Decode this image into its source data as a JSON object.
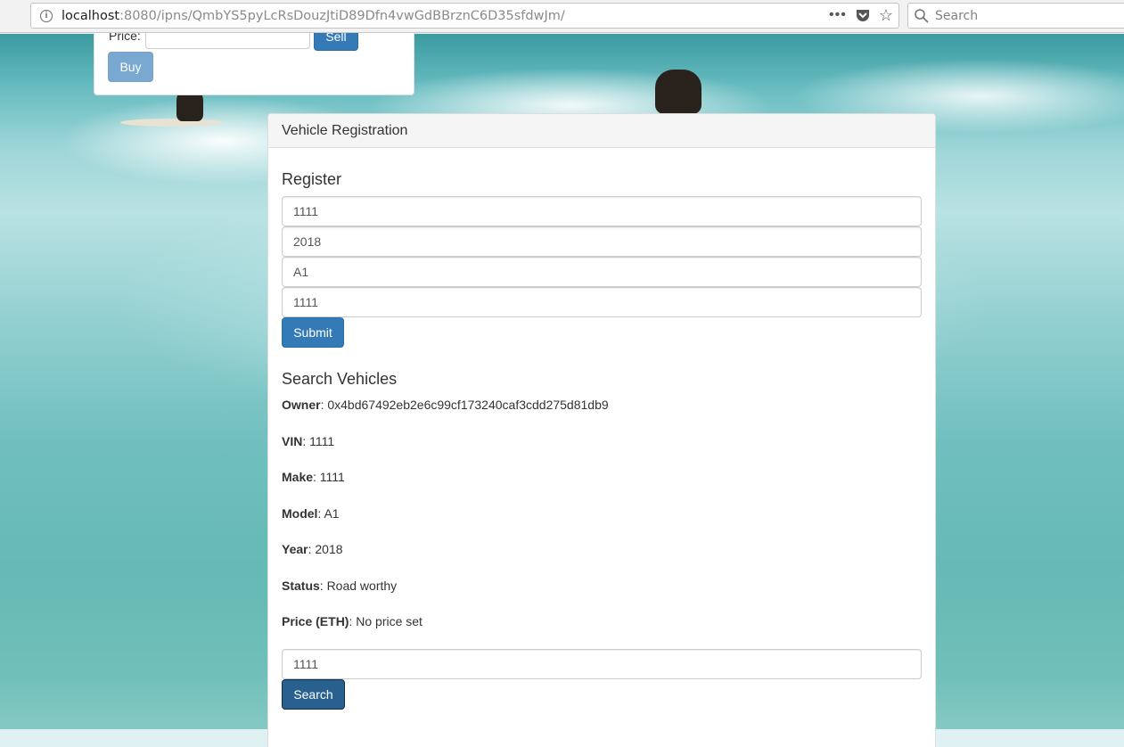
{
  "browser": {
    "url_host": "localhost",
    "url_rest": ":8080/ipns/QmbYS5pyLcRsDouzJtiD89Dfn4vwGdBBrznC6D35sfdwJm/",
    "search_placeholder": "Search",
    "icons": [
      "info-icon",
      "more-dots-icon",
      "pocket-icon",
      "bookmark-star-icon",
      "search-icon"
    ]
  },
  "trade_panel": {
    "price_label": "Price:",
    "price_value": "",
    "sell_label": "Sell",
    "buy_label": "Buy"
  },
  "registration": {
    "heading": "Vehicle Registration",
    "register_title": "Register",
    "fields": [
      "1111",
      "2018",
      "A1",
      "1111"
    ],
    "submit_label": "Submit"
  },
  "search": {
    "title": "Search Vehicles",
    "results": [
      {
        "label": "Owner",
        "value": ": 0x4bd67492eb2e6c99cf173240caf3cdd275d81db9"
      },
      {
        "label": "VIN",
        "value": ": 1111"
      },
      {
        "label": "Make",
        "value": ": 1111"
      },
      {
        "label": "Model",
        "value": ": A1"
      },
      {
        "label": "Year",
        "value": ": 2018"
      },
      {
        "label": "Status",
        "value": ": Road worthy"
      },
      {
        "label": "Price (ETH)",
        "value": ": No price set"
      }
    ],
    "query_value": "1111",
    "search_label": "Search"
  },
  "colors": {
    "primary": "#337ab7",
    "primary_active": "#286090",
    "panel_heading_bg": "#f5f5f5",
    "ocean": "#70bfbe"
  }
}
